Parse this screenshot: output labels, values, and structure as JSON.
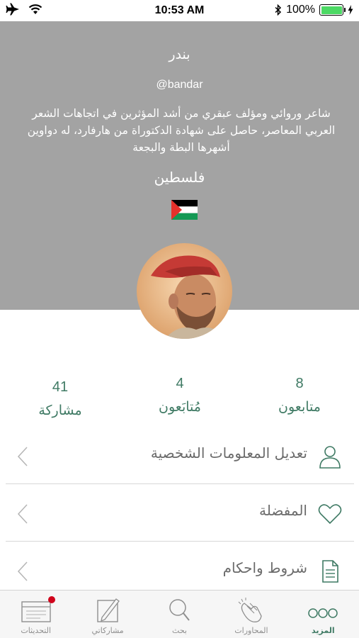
{
  "status_bar": {
    "time": "10:53 AM",
    "battery_text": "100%",
    "battery_level": 1.0
  },
  "profile": {
    "name": "بندر",
    "handle": "@bandar",
    "bio": "شاعر وروائي ومؤلف عبقري من أشد المؤثرين في اتجاهات الشعر العربي المعاصر، حاصل على شهادة الدكتوراة من هارفارد، له دواوين أشهرها البطة والبجعة",
    "country": "فلسطين"
  },
  "stats": [
    {
      "value": "8",
      "label": "متابعون"
    },
    {
      "value": "4",
      "label": "مُتابَعون"
    },
    {
      "value": "41",
      "label": "مشاركة"
    }
  ],
  "menu": [
    {
      "label": "تعديل المعلومات الشخصية",
      "icon": "user-icon"
    },
    {
      "label": "المفضلة",
      "icon": "heart-icon"
    },
    {
      "label": "شروط واحكام",
      "icon": "document-icon"
    }
  ],
  "tab_bar": {
    "tabs": [
      {
        "label": "التحديثات",
        "icon": "calendar-icon"
      },
      {
        "label": "مشاركاتي",
        "icon": "pen-icon"
      },
      {
        "label": "بحث",
        "icon": "search-icon"
      },
      {
        "label": "المحاورات",
        "icon": "clapping-hands-icon"
      },
      {
        "label": "المزيد",
        "icon": "more-dots-icon",
        "active": true
      }
    ]
  },
  "colors": {
    "accent": "#3f7a64",
    "header_bg": "#a3a3a3",
    "notification": "#d0021b"
  }
}
